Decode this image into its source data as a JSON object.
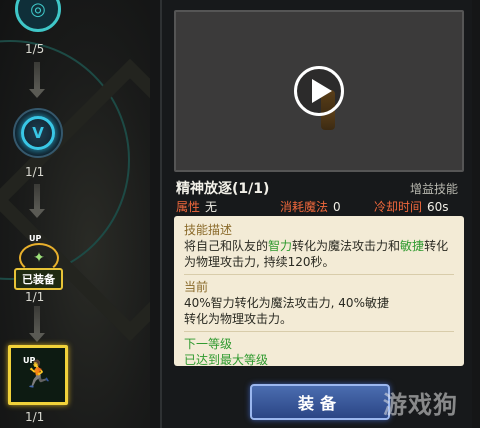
{
  "tree": {
    "nodes": [
      {
        "count": "1/5"
      },
      {
        "count": "1/1",
        "glyph": "V"
      },
      {
        "count": "1/1",
        "up": "UP",
        "badge": "已装备"
      },
      {
        "count": "1/1",
        "up": "UP"
      }
    ]
  },
  "skill": {
    "name": "精神放逐(1/1)",
    "type": "增益技能",
    "attr_label": "属性",
    "attr_value": "无",
    "mana_label": "消耗魔法",
    "mana_value": "0",
    "cooldown_label": "冷却时间",
    "cooldown_value": "60s"
  },
  "description": {
    "title": "技能描述",
    "text_1": "将自己和队友的",
    "hl_1": "智力",
    "text_2": "转化为魔法攻击力和",
    "hl_2": "敏捷",
    "text_3": "转化为物理攻击力, 持续120秒。",
    "current_title": "当前",
    "current_1": "40%智力转化为魔法攻击力, 40%敏捷",
    "current_2": "转化为物理攻击力。",
    "next_title": "下一等级",
    "next_text": "已达到最大等级"
  },
  "equip_button": "装备",
  "watermark": "游戏狗",
  "colors": {
    "accent_gold": "#f1d23a",
    "stat_label": "#f0683c",
    "highlight_green": "#2f9a2f",
    "button_blue": "#2b4585"
  }
}
